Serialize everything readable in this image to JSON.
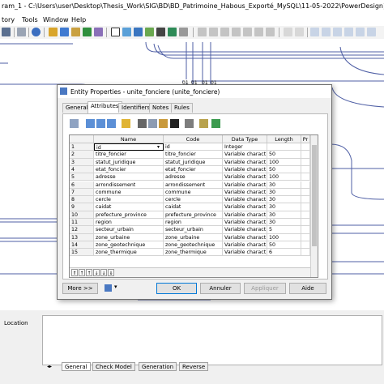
{
  "window": {
    "title": "ram_1 - C:\\Users\\user\\Desktop\\Thesis_Work\\SIG\\BD\\BD_Patrimoine_Habous_Exporté_MySQL\\11-05-2022\\PowerDesign)"
  },
  "menu": {
    "items": [
      "tory",
      "Tools",
      "Window",
      "Help"
    ]
  },
  "diagram": {
    "column_labels": [
      "01",
      "01",
      "01",
      "01"
    ]
  },
  "dialog": {
    "title": "Entity Properties - unite_fonciere (unite_fonciere)",
    "tabs": [
      "General",
      "Attributes",
      "Identifiers",
      "Notes",
      "Rules"
    ],
    "active_tab": "Attributes",
    "grid": {
      "columns": [
        "Name",
        "Code",
        "Data Type",
        "Length",
        "Pr"
      ],
      "rows": [
        {
          "num": "1",
          "name": "id",
          "code": "id",
          "type": "Integer",
          "length": ""
        },
        {
          "num": "2",
          "name": "titre_foncier",
          "code": "titre_foncier",
          "type": "Variable charact",
          "length": "50"
        },
        {
          "num": "3",
          "name": "statut_juridique",
          "code": "statut_juridique",
          "type": "Variable charact",
          "length": "100"
        },
        {
          "num": "4",
          "name": "etat_foncier",
          "code": "etat_foncier",
          "type": "Variable charact",
          "length": "50"
        },
        {
          "num": "5",
          "name": "adresse",
          "code": "adresse",
          "type": "Variable charact",
          "length": "100"
        },
        {
          "num": "6",
          "name": "arrondissement",
          "code": "arrondissement",
          "type": "Variable charact",
          "length": "30"
        },
        {
          "num": "7",
          "name": "commune",
          "code": "commune",
          "type": "Variable charact",
          "length": "30"
        },
        {
          "num": "8",
          "name": "cercle",
          "code": "cercle",
          "type": "Variable charact",
          "length": "30"
        },
        {
          "num": "9",
          "name": "caidat",
          "code": "caidat",
          "type": "Variable charact",
          "length": "30"
        },
        {
          "num": "10",
          "name": "prefecture_province",
          "code": "prefecture_province",
          "type": "Variable charact",
          "length": "30"
        },
        {
          "num": "11",
          "name": "region",
          "code": "region",
          "type": "Variable charact",
          "length": "30"
        },
        {
          "num": "12",
          "name": "secteur_urbain",
          "code": "secteur_urbain",
          "type": "Variable charact",
          "length": "5"
        },
        {
          "num": "13",
          "name": "zone_urbaine",
          "code": "zone_urbaine",
          "type": "Variable charact",
          "length": "100"
        },
        {
          "num": "14",
          "name": "zone_geotechnique",
          "code": "zone_geotechnique",
          "type": "Variable charact",
          "length": "50"
        },
        {
          "num": "15",
          "name": "zone_thermique",
          "code": "zone_thermique",
          "type": "Variable charact",
          "length": "6"
        }
      ]
    },
    "buttons": {
      "more": "More >>",
      "ok": "OK",
      "cancel": "Annuler",
      "apply": "Appliquer",
      "help": "Aide"
    }
  },
  "output": {
    "location_label": "Location",
    "tabs": [
      "General",
      "Check Model",
      "Generation",
      "Reverse"
    ]
  },
  "colors": {
    "accent": "#0078d7",
    "title_icon": "#4a78c2"
  }
}
